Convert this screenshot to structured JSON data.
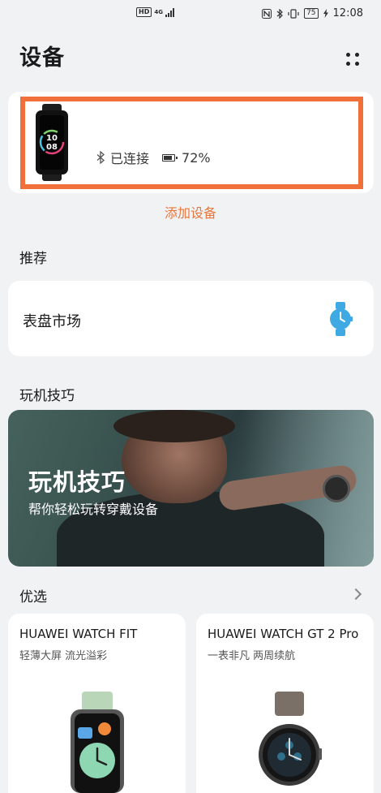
{
  "status_bar": {
    "hd_badge": "HD",
    "network": "4G",
    "battery_badge": "75",
    "time": "12:08"
  },
  "header": {
    "title": "设备",
    "more_icon": "more-dots-icon"
  },
  "device": {
    "connection_status": "已连接",
    "battery": "72%",
    "band_display": "10 08"
  },
  "add_device_label": "添加设备",
  "recommend": {
    "section_title": "推荐",
    "watchface_market_label": "表盘市场",
    "icon": "watch-icon",
    "accent_color": "#3fa9e4"
  },
  "tips": {
    "section_title": "玩机技巧",
    "banner_title": "玩机技巧",
    "banner_subtitle": "帮你轻松玩转穿戴设备"
  },
  "picks": {
    "section_title": "优选",
    "products": [
      {
        "name": "HUAWEI WATCH FIT",
        "description": "轻薄大屏 流光溢彩"
      },
      {
        "name": "HUAWEI WATCH GT 2 Pro",
        "description": "一表非凡 两周续航"
      }
    ]
  },
  "colors": {
    "accent_orange": "#e8773e",
    "highlight_border": "#f0703a",
    "background": "#f1f2f4"
  }
}
